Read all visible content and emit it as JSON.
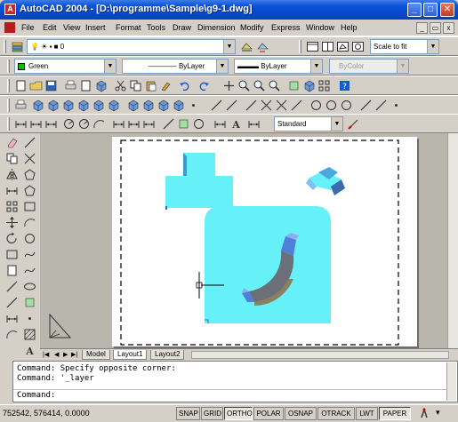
{
  "window": {
    "title": "AutoCAD 2004 - [D:\\programme\\Sample\\g9-1.dwg]",
    "icon_letter": "A"
  },
  "window_controls": {
    "minimize": "_",
    "maximize": "□",
    "close": "✕"
  },
  "menu": {
    "items": [
      "File",
      "Edit",
      "View",
      "Insert",
      "Format",
      "Tools",
      "Draw",
      "Dimension",
      "Modify",
      "Express",
      "Window",
      "Help"
    ],
    "doc_controls": {
      "minimize": "_",
      "restore": "▭",
      "close": "x"
    }
  },
  "layer_toolbar": {
    "current_layer": "0"
  },
  "view_toolbar": {
    "scale": "Scale to fit"
  },
  "properties_toolbar": {
    "color": "Green",
    "color_hex": "#00c000",
    "linetype": "ByLayer",
    "lineweight": "ByLayer",
    "plotstyle": "ByColor"
  },
  "dim_toolbar": {
    "dimstyle": "Standard"
  },
  "tabs": {
    "model": "Model",
    "layout1": "Layout1",
    "layout2": "Layout2"
  },
  "command": {
    "history": [
      "Command: Specify opposite corner:",
      "Command: '_layer"
    ],
    "prompt": "Command:"
  },
  "status": {
    "coords": "752542, 576414, 0.0000",
    "buttons": [
      "SNAP",
      "GRID",
      "ORTHO",
      "POLAR",
      "OSNAP",
      "OTRACK",
      "LWT",
      "PAPER"
    ]
  },
  "colors": {
    "title_blue": "#0447c4",
    "model_cyan": "#66f0f8",
    "model_shadow": "#3a6bb0"
  }
}
